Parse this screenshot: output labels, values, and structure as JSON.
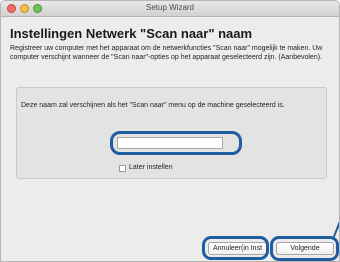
{
  "window": {
    "title": "Setup Wizard"
  },
  "page": {
    "heading": "Instellingen Netwerk \"Scan naar\" naam",
    "intro": "Registreer uw computer met het apparaat om de netwerkfuncties \"Scan naar\" mogelijk te maken. Uw computer verschijnt wanneer de \"Scan naar\"-opties op het apparaat geselecteerd zijn. (Aanbevolen)."
  },
  "panel": {
    "description": "Deze naam zal verschijnen als het \"Scan naar\" menu op de machine geselecteerd is.",
    "name_value": "",
    "later_label": "Later instellen",
    "later_checked": false
  },
  "buttons": {
    "cancel_label": "Annuleer(in Inst",
    "next_label": "Volgende"
  },
  "colors": {
    "highlight": "#1e5ea0"
  }
}
